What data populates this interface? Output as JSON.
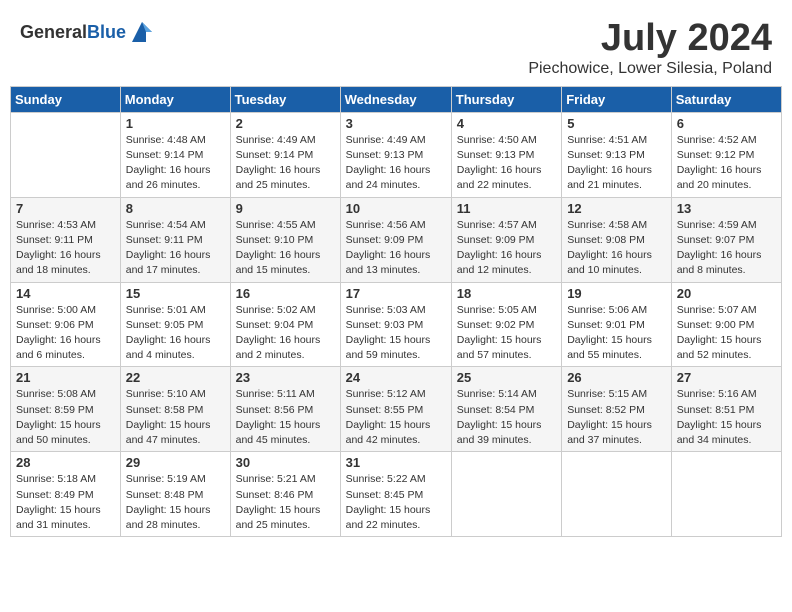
{
  "header": {
    "logo_general": "General",
    "logo_blue": "Blue",
    "month_year": "July 2024",
    "location": "Piechowice, Lower Silesia, Poland"
  },
  "weekdays": [
    "Sunday",
    "Monday",
    "Tuesday",
    "Wednesday",
    "Thursday",
    "Friday",
    "Saturday"
  ],
  "weeks": [
    [
      {
        "day": "",
        "sunrise": "",
        "sunset": "",
        "daylight": ""
      },
      {
        "day": "1",
        "sunrise": "Sunrise: 4:48 AM",
        "sunset": "Sunset: 9:14 PM",
        "daylight": "Daylight: 16 hours and 26 minutes."
      },
      {
        "day": "2",
        "sunrise": "Sunrise: 4:49 AM",
        "sunset": "Sunset: 9:14 PM",
        "daylight": "Daylight: 16 hours and 25 minutes."
      },
      {
        "day": "3",
        "sunrise": "Sunrise: 4:49 AM",
        "sunset": "Sunset: 9:13 PM",
        "daylight": "Daylight: 16 hours and 24 minutes."
      },
      {
        "day": "4",
        "sunrise": "Sunrise: 4:50 AM",
        "sunset": "Sunset: 9:13 PM",
        "daylight": "Daylight: 16 hours and 22 minutes."
      },
      {
        "day": "5",
        "sunrise": "Sunrise: 4:51 AM",
        "sunset": "Sunset: 9:13 PM",
        "daylight": "Daylight: 16 hours and 21 minutes."
      },
      {
        "day": "6",
        "sunrise": "Sunrise: 4:52 AM",
        "sunset": "Sunset: 9:12 PM",
        "daylight": "Daylight: 16 hours and 20 minutes."
      }
    ],
    [
      {
        "day": "7",
        "sunrise": "Sunrise: 4:53 AM",
        "sunset": "Sunset: 9:11 PM",
        "daylight": "Daylight: 16 hours and 18 minutes."
      },
      {
        "day": "8",
        "sunrise": "Sunrise: 4:54 AM",
        "sunset": "Sunset: 9:11 PM",
        "daylight": "Daylight: 16 hours and 17 minutes."
      },
      {
        "day": "9",
        "sunrise": "Sunrise: 4:55 AM",
        "sunset": "Sunset: 9:10 PM",
        "daylight": "Daylight: 16 hours and 15 minutes."
      },
      {
        "day": "10",
        "sunrise": "Sunrise: 4:56 AM",
        "sunset": "Sunset: 9:09 PM",
        "daylight": "Daylight: 16 hours and 13 minutes."
      },
      {
        "day": "11",
        "sunrise": "Sunrise: 4:57 AM",
        "sunset": "Sunset: 9:09 PM",
        "daylight": "Daylight: 16 hours and 12 minutes."
      },
      {
        "day": "12",
        "sunrise": "Sunrise: 4:58 AM",
        "sunset": "Sunset: 9:08 PM",
        "daylight": "Daylight: 16 hours and 10 minutes."
      },
      {
        "day": "13",
        "sunrise": "Sunrise: 4:59 AM",
        "sunset": "Sunset: 9:07 PM",
        "daylight": "Daylight: 16 hours and 8 minutes."
      }
    ],
    [
      {
        "day": "14",
        "sunrise": "Sunrise: 5:00 AM",
        "sunset": "Sunset: 9:06 PM",
        "daylight": "Daylight: 16 hours and 6 minutes."
      },
      {
        "day": "15",
        "sunrise": "Sunrise: 5:01 AM",
        "sunset": "Sunset: 9:05 PM",
        "daylight": "Daylight: 16 hours and 4 minutes."
      },
      {
        "day": "16",
        "sunrise": "Sunrise: 5:02 AM",
        "sunset": "Sunset: 9:04 PM",
        "daylight": "Daylight: 16 hours and 2 minutes."
      },
      {
        "day": "17",
        "sunrise": "Sunrise: 5:03 AM",
        "sunset": "Sunset: 9:03 PM",
        "daylight": "Daylight: 15 hours and 59 minutes."
      },
      {
        "day": "18",
        "sunrise": "Sunrise: 5:05 AM",
        "sunset": "Sunset: 9:02 PM",
        "daylight": "Daylight: 15 hours and 57 minutes."
      },
      {
        "day": "19",
        "sunrise": "Sunrise: 5:06 AM",
        "sunset": "Sunset: 9:01 PM",
        "daylight": "Daylight: 15 hours and 55 minutes."
      },
      {
        "day": "20",
        "sunrise": "Sunrise: 5:07 AM",
        "sunset": "Sunset: 9:00 PM",
        "daylight": "Daylight: 15 hours and 52 minutes."
      }
    ],
    [
      {
        "day": "21",
        "sunrise": "Sunrise: 5:08 AM",
        "sunset": "Sunset: 8:59 PM",
        "daylight": "Daylight: 15 hours and 50 minutes."
      },
      {
        "day": "22",
        "sunrise": "Sunrise: 5:10 AM",
        "sunset": "Sunset: 8:58 PM",
        "daylight": "Daylight: 15 hours and 47 minutes."
      },
      {
        "day": "23",
        "sunrise": "Sunrise: 5:11 AM",
        "sunset": "Sunset: 8:56 PM",
        "daylight": "Daylight: 15 hours and 45 minutes."
      },
      {
        "day": "24",
        "sunrise": "Sunrise: 5:12 AM",
        "sunset": "Sunset: 8:55 PM",
        "daylight": "Daylight: 15 hours and 42 minutes."
      },
      {
        "day": "25",
        "sunrise": "Sunrise: 5:14 AM",
        "sunset": "Sunset: 8:54 PM",
        "daylight": "Daylight: 15 hours and 39 minutes."
      },
      {
        "day": "26",
        "sunrise": "Sunrise: 5:15 AM",
        "sunset": "Sunset: 8:52 PM",
        "daylight": "Daylight: 15 hours and 37 minutes."
      },
      {
        "day": "27",
        "sunrise": "Sunrise: 5:16 AM",
        "sunset": "Sunset: 8:51 PM",
        "daylight": "Daylight: 15 hours and 34 minutes."
      }
    ],
    [
      {
        "day": "28",
        "sunrise": "Sunrise: 5:18 AM",
        "sunset": "Sunset: 8:49 PM",
        "daylight": "Daylight: 15 hours and 31 minutes."
      },
      {
        "day": "29",
        "sunrise": "Sunrise: 5:19 AM",
        "sunset": "Sunset: 8:48 PM",
        "daylight": "Daylight: 15 hours and 28 minutes."
      },
      {
        "day": "30",
        "sunrise": "Sunrise: 5:21 AM",
        "sunset": "Sunset: 8:46 PM",
        "daylight": "Daylight: 15 hours and 25 minutes."
      },
      {
        "day": "31",
        "sunrise": "Sunrise: 5:22 AM",
        "sunset": "Sunset: 8:45 PM",
        "daylight": "Daylight: 15 hours and 22 minutes."
      },
      {
        "day": "",
        "sunrise": "",
        "sunset": "",
        "daylight": ""
      },
      {
        "day": "",
        "sunrise": "",
        "sunset": "",
        "daylight": ""
      },
      {
        "day": "",
        "sunrise": "",
        "sunset": "",
        "daylight": ""
      }
    ]
  ]
}
